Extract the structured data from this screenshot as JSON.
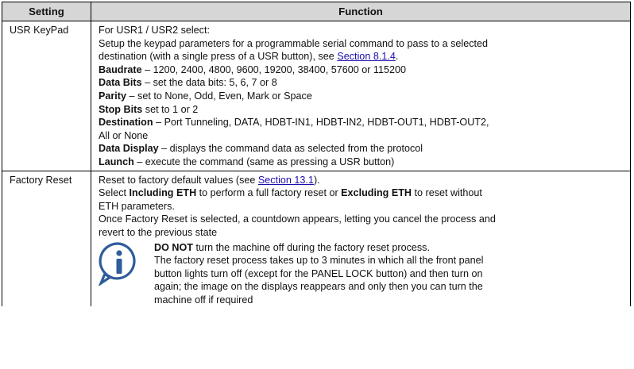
{
  "headers": {
    "setting": "Setting",
    "function": "Function"
  },
  "usr": {
    "name": "USR KeyPad",
    "l1": "For USR1 / USR2 select:",
    "l2": "Setup the keypad parameters for a programmable serial command to pass to a selected",
    "l3a": "destination (with a single press of a USR button), see ",
    "l3link": "Section 8.1.4",
    "l3b": ".",
    "baud_b": "Baudrate",
    "baud_t": " – 1200, 2400, 4800, 9600, 19200, 38400, 57600 or 115200",
    "data_b": "Data Bits",
    "data_t": " – set the data bits: 5, 6, 7 or 8",
    "parity_b": "Parity",
    "parity_t": " – set to None, Odd, Even, Mark or Space",
    "stop_b": "Stop Bits",
    "stop_t": " set to 1 or 2",
    "dest_b": "Destination",
    "dest_t": " – Port Tunneling, DATA, HDBT-IN1, HDBT-IN2, HDBT-OUT1, HDBT-OUT2,",
    "dest_t2": "All or None",
    "disp_b": "Data Display",
    "disp_t": " – displays the command data as selected from the protocol",
    "launch_b": "Launch",
    "launch_t": " – execute the command (same as pressing a USR button)"
  },
  "factory": {
    "name": "Factory Reset",
    "l1a": "Reset to factory default values (see ",
    "l1link": "Section 13.1",
    "l1b": ").",
    "l2a": "Select ",
    "l2b": "Including ETH",
    "l2c": " to perform a full factory reset or ",
    "l2d": "Excluding ETH",
    "l2e": " to reset without",
    "l3": "ETH parameters.",
    "l4": "Once Factory Reset is selected, a countdown appears, letting you cancel the process and",
    "l5": "revert to the previous state",
    "note_b": "DO NOT",
    "note_t1": " turn the machine off during the factory reset process.",
    "note_t2": "The factory reset process takes up to 3 minutes in which all the front panel",
    "note_t3": "button lights turn off (except for the PANEL LOCK button) and then turn on",
    "note_t4": "again; the image on the displays reappears and only then you can turn the",
    "note_t5": "machine off if required"
  },
  "icon": {
    "name": "info-icon",
    "color": "#2f5c9a"
  }
}
